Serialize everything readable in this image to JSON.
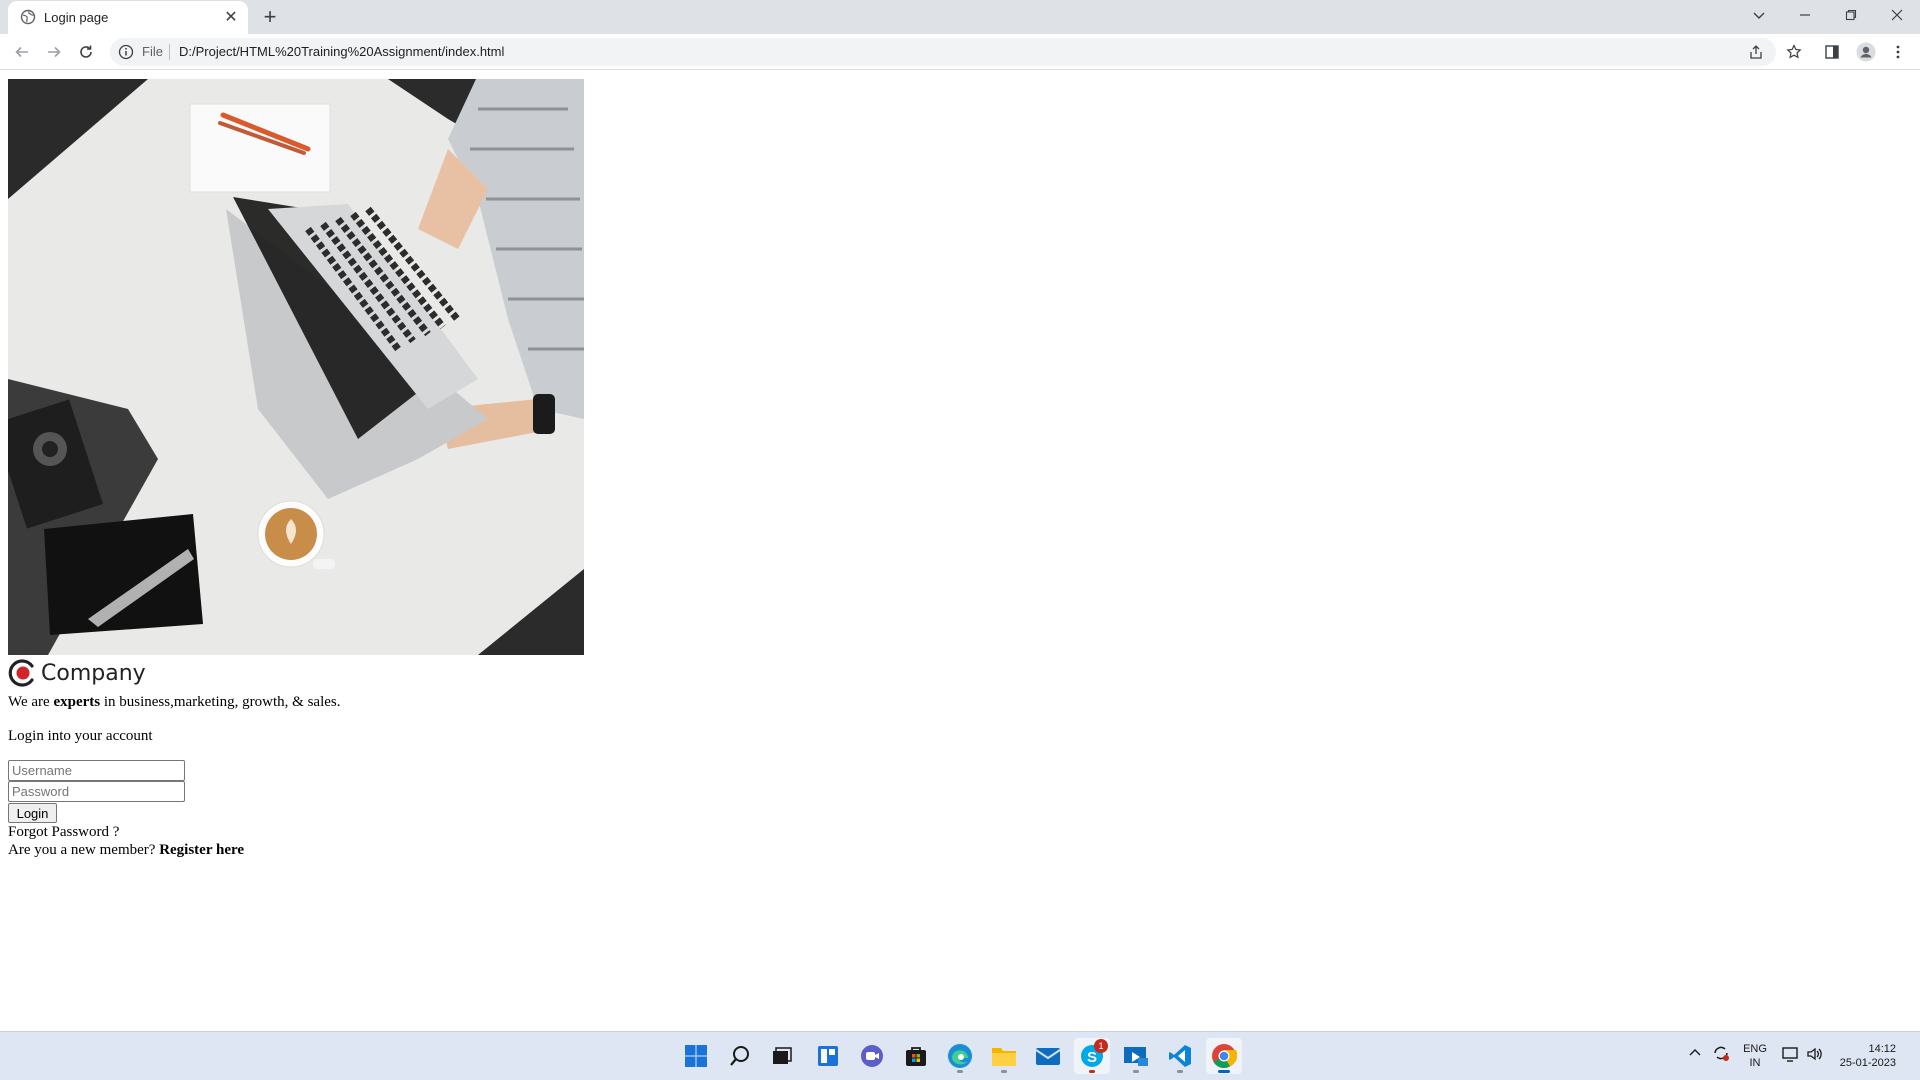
{
  "browser": {
    "tab_title": "Login page",
    "close_tab_glyph": "✕",
    "new_tab_glyph": "+",
    "scheme_label": "File",
    "url": "D:/Project/HTML%20Training%20Assignment/index.html"
  },
  "page": {
    "hero_alt": "Person typing on laptop at desk with coffee",
    "brand_name": "Company",
    "tagline_prefix": "We are ",
    "tagline_bold": "experts",
    "tagline_suffix": " in business,marketing, growth, & sales.",
    "subheading": "Login into your account",
    "username_placeholder": "Username",
    "password_placeholder": "Password",
    "login_label": "Login",
    "forgot_label": "Forgot Password ?",
    "register_prompt": "Are you a new member? ",
    "register_link": "Register here"
  },
  "taskbar": {
    "skype_badge": "1",
    "lang_line1": "ENG",
    "lang_line2": "IN",
    "time": "14:12",
    "date": "25-01-2023"
  },
  "colors": {
    "accent": "#0067c0",
    "logo_red": "#d0232a",
    "logo_dark": "#222222"
  }
}
